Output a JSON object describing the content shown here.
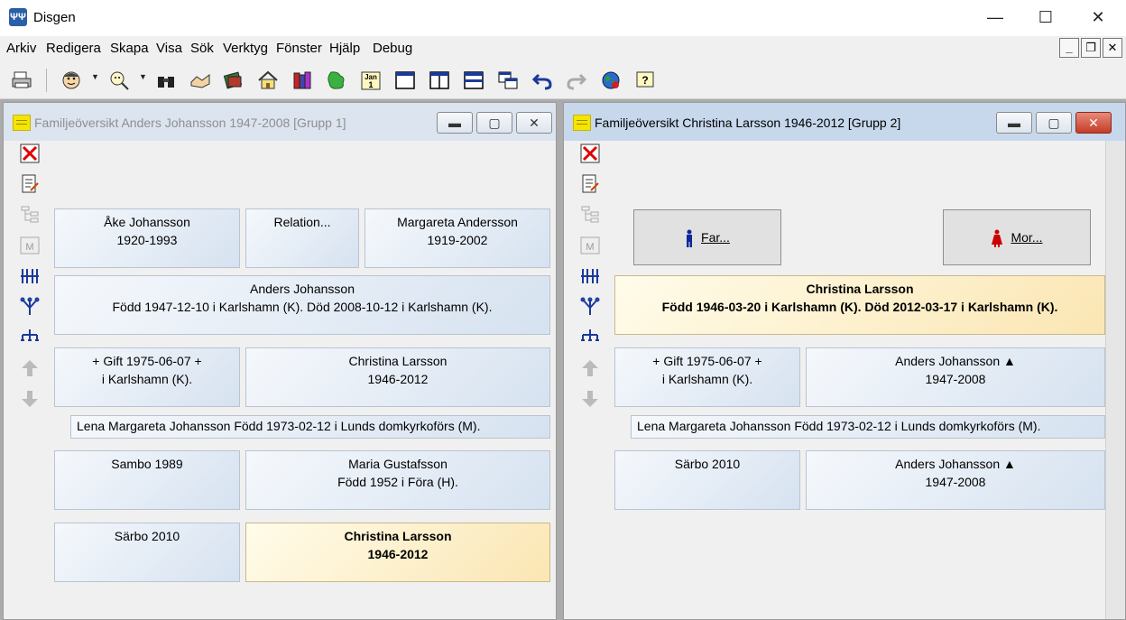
{
  "app": {
    "title": "Disgen"
  },
  "window_controls": {
    "minimize": "—",
    "maximize": "☐",
    "close": "✕"
  },
  "menu": [
    "Arkiv",
    "Redigera",
    "Skapa",
    "Visa",
    "Sök",
    "Verktyg",
    "Fönster",
    "Hjälp",
    "Debug"
  ],
  "toolbar_icons": [
    "print-icon",
    "person-icon",
    "person-search-icon",
    "binoculars-icon",
    "handshake-icon",
    "book-icon",
    "home-icon",
    "books-icon",
    "map-icon",
    "calendar-icon",
    "window-single-icon",
    "window-split-vertical-icon",
    "window-split-horizontal-icon",
    "window-cascade-icon",
    "undo-icon",
    "redo-icon",
    "globe-icon",
    "help-icon"
  ],
  "calendar_icon_text": "Jan\n1",
  "left": {
    "title": "Familjeöversikt Anders Johansson 1947-2008 [Grupp 1]",
    "father": {
      "name": "Åke Johansson",
      "years": "1920-1993"
    },
    "relation": "Relation...",
    "mother": {
      "name": "Margareta Andersson",
      "years": "1919-2002"
    },
    "person": {
      "name": "Anders Johansson",
      "info": "Född 1947-12-10 i Karlshamn (K). Död 2008-10-12 i Karlshamn (K)."
    },
    "relations": [
      {
        "line1": "+ Gift 1975-06-07 +",
        "line2": "i  Karlshamn (K).",
        "partner_name": "Christina Larsson",
        "partner_info": "1946-2012"
      },
      {
        "line1": "Sambo 1989",
        "line2": "",
        "partner_name": "Maria Gustafsson",
        "partner_info": "Född 1952 i Föra (H)."
      },
      {
        "line1": "Särbo 2010",
        "line2": "",
        "partner_name": "Christina Larsson",
        "partner_info": "1946-2012"
      }
    ],
    "child": "Lena Margareta Johansson Född 1973-02-12 i Lunds domkyrkoförs (M)."
  },
  "right": {
    "title": "Familjeöversikt Christina Larsson 1946-2012 [Grupp 2]",
    "father_button": "Far...",
    "mother_button": "Mor...",
    "person": {
      "name": "Christina Larsson",
      "info": "Född 1946-03-20 i Karlshamn (K). Död 2012-03-17 i Karlshamn (K)."
    },
    "relations": [
      {
        "line1": "+ Gift 1975-06-07 +",
        "line2": "i  Karlshamn (K).",
        "partner_name": "Anders Johansson ▲",
        "partner_info": "1947-2008"
      },
      {
        "line1": "Särbo 2010",
        "line2": "",
        "partner_name": "Anders Johansson ▲",
        "partner_info": "1947-2008"
      }
    ],
    "child": "Lena Margareta Johansson Född 1973-02-12 i Lunds domkyrkoförs (M)."
  },
  "side_icons": [
    "delete-icon",
    "edit-notes-icon",
    "tree-list-icon",
    "family-group-icon",
    "columns-icon",
    "descendants-icon",
    "pedigree-icon",
    "move-up-icon",
    "move-down-icon"
  ],
  "colors": {
    "selected_box": "#fbe6b3",
    "normal_box": "#d6e2f0",
    "title_active": "#c7d8ec",
    "title_inactive": "#dbe4ef"
  }
}
